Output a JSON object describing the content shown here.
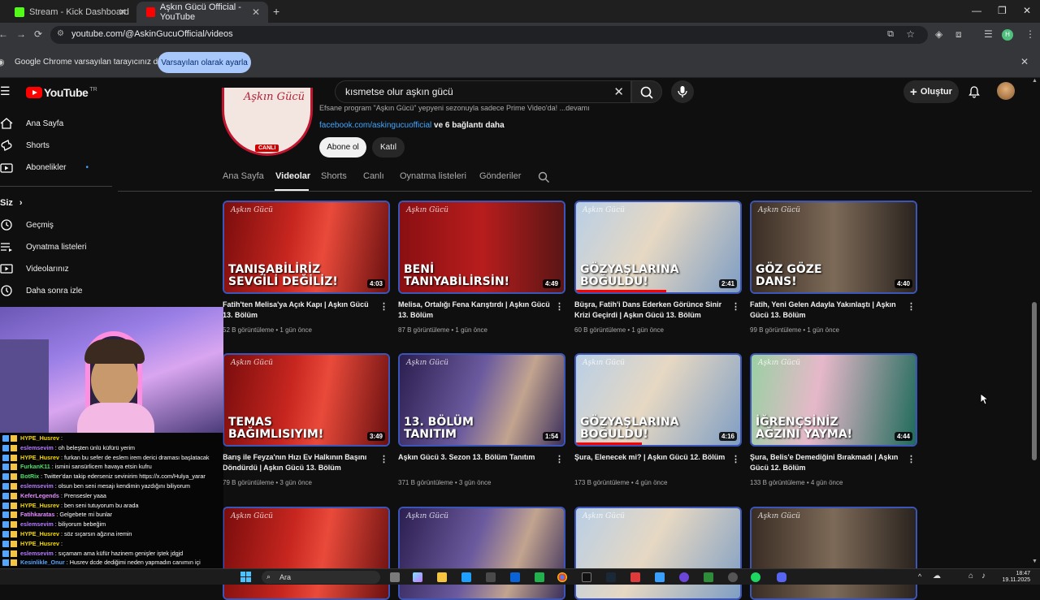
{
  "browser": {
    "tabs": [
      {
        "title": "Stream - Kick Dashboard",
        "active": false,
        "favicon_color": "#53fc18"
      },
      {
        "title": "Aşkın Gücü Official - YouTube",
        "active": true,
        "favicon_color": "#ff0000"
      }
    ],
    "url": "youtube.com/@AskinGucuOfficial/videos",
    "infobar": {
      "message": "Google Chrome varsayılan tarayıcınız değil",
      "button": "Varsayılan olarak ayarla"
    }
  },
  "youtube": {
    "logo_text": "YouTube",
    "logo_suffix": "TR",
    "search_value": "kısmetse olur aşkın gücü",
    "create_label": "Oluştur",
    "sidebar": {
      "items": [
        {
          "label": "Ana Sayfa",
          "icon": "home-icon"
        },
        {
          "label": "Shorts",
          "icon": "shorts-icon"
        },
        {
          "label": "Abonelikler",
          "icon": "subscriptions-icon"
        }
      ],
      "section": "Siz",
      "you_items": [
        {
          "label": "Geçmiş",
          "icon": "history-icon"
        },
        {
          "label": "Oynatma listeleri",
          "icon": "playlist-icon"
        },
        {
          "label": "Videolarınız",
          "icon": "your-videos-icon"
        },
        {
          "label": "Daha sonra izle",
          "icon": "watch-later-icon"
        }
      ]
    },
    "channel": {
      "live_badge": "CANLI",
      "description": "Efsane program \"Aşkın Gücü\" yepyeni sezonuyla sadece Prime Video'da! ...devamı",
      "link": "facebook.com/askingucuofficial",
      "more_links": " ve 6 bağlantı daha",
      "subscribe": "Abone ol",
      "join": "Katıl",
      "tabs": [
        "Ana Sayfa",
        "Videolar",
        "Shorts",
        "Canlı",
        "Oynatma listeleri",
        "Gönderiler"
      ],
      "active_tab": "Videolar"
    },
    "videos": [
      {
        "caption": "TANIŞABİLİRİZ\nSEVGİLİ DEĞİLİZ!",
        "duration": "4:03",
        "title": "Fatih'ten Melisa'ya Açık Kapı | Aşkın Gücü 13. Bölüm",
        "meta": "52 B görüntüleme • 1 gün önce",
        "scene": "red",
        "watched": 0
      },
      {
        "caption": "BENİ\nTANIYABİLİRSİN!",
        "duration": "4:49",
        "title": "Melisa, Ortalığı Fena Karıştırdı | Aşkın Gücü 13. Bölüm",
        "meta": "87 B görüntüleme • 1 gün önce",
        "scene": "red2",
        "watched": 0
      },
      {
        "caption": "GÖZYAŞLARINA\nBOĞULDU!",
        "duration": "2:41",
        "title": "Büşra, Fatih'i Dans Ederken Görünce Sinir Krizi Geçirdi | Aşkın Gücü 13. Bölüm",
        "meta": "60 B görüntüleme • 1 gün önce",
        "scene": "blue",
        "watched": 0.55
      },
      {
        "caption": "GÖZ GÖZE\nDANS!",
        "duration": "4:40",
        "title": "Fatih, Yeni Gelen Adayla Yakınlaştı | Aşkın Gücü 13. Bölüm",
        "meta": "99 B görüntüleme • 1 gün önce",
        "scene": "brown",
        "watched": 0
      },
      {
        "caption": "TEMAS\nBAĞIMLISIYIM!",
        "duration": "3:49",
        "title": "Barış ile Feyza'nın Hızı Ev Halkının Başını Döndürdü | Aşkın Gücü 13. Bölüm",
        "meta": "79 B görüntüleme • 3 gün önce",
        "scene": "red",
        "watched": 0
      },
      {
        "caption": "13. BÖLÜM\nTANITIM",
        "duration": "1:54",
        "title": "Aşkın Gücü 3. Sezon 13. Bölüm Tanıtım",
        "meta": "371 B görüntüleme • 3 gün önce",
        "scene": "purple",
        "watched": 0
      },
      {
        "caption": "GÖZYAŞLARINA\nBOĞULDU!",
        "duration": "4:16",
        "title": "Şura, Elenecek mi? | Aşkın Gücü 12. Bölüm",
        "meta": "173 B görüntüleme • 4 gün önce",
        "scene": "blue",
        "watched": 0.4
      },
      {
        "caption": "İĞRENÇSİNİZ\nAĞZINI YAYMA!",
        "duration": "4:44",
        "title": "Şura, Belis'e Demediğini Bırakmadı | Aşkın Gücü 12. Bölüm",
        "meta": "133 B görüntüleme • 4 gün önce",
        "scene": "green",
        "watched": 0
      },
      {
        "caption": "",
        "duration": "",
        "title": "",
        "meta": "",
        "scene": "red",
        "watched": 0
      },
      {
        "caption": "",
        "duration": "",
        "title": "",
        "meta": "",
        "scene": "purple",
        "watched": 0
      },
      {
        "caption": "",
        "duration": "",
        "title": "",
        "meta": "",
        "scene": "blue",
        "watched": 0
      },
      {
        "caption": "",
        "duration": "",
        "title": "",
        "meta": "",
        "scene": "brown",
        "watched": 0
      }
    ]
  },
  "chat": [
    {
      "user": "HYPE_Husrev",
      "text": " :",
      "color": "#f5d90a"
    },
    {
      "user": "eslemsevim",
      "text": " : oh beleşten ünlü küfürü yerim",
      "color": "#b57bff"
    },
    {
      "user": "HYPE_Husrev",
      "text": " : furkan bu sefer de eslem irem derici draması başlatacak",
      "color": "#f5d90a"
    },
    {
      "user": "FurkanK11",
      "text": " : ismini sansürlicem havaya etsin kufru",
      "color": "#4ce06b"
    },
    {
      "user": "BotRix",
      "text": " : Twitter'dan takip ederseniz sevinirim https://x.com/Hulya_yarar",
      "color": "#4ce06b"
    },
    {
      "user": "eslemsevim",
      "text": " : olsun ben seni mesajı kendimin yazdığını biliyorum",
      "color": "#b57bff"
    },
    {
      "user": "KeferLegends",
      "text": " : Prensesler yaaa",
      "color": "#e28aff"
    },
    {
      "user": "HYPE_Husrev",
      "text": " : ben seni tutuyorum bu arada",
      "color": "#f5d90a"
    },
    {
      "user": "Fatihkaratas",
      "text": " : Gelgebete mi bunlar",
      "color": "#e28aff"
    },
    {
      "user": "eslemsevim",
      "text": " : biliyorum bebeğim",
      "color": "#b57bff"
    },
    {
      "user": "HYPE_Husrev",
      "text": " : söz sıçarsın ağzına iremin",
      "color": "#f5d90a"
    },
    {
      "user": "HYPE_Husrev",
      "text": " :",
      "color": "#f5d90a"
    },
    {
      "user": "eslemsevim",
      "text": " : sıçamam ama küfür hazinem genişler iştek jdgjd",
      "color": "#b57bff"
    },
    {
      "user": "Kesinlikle_Onur",
      "text": " : Husrev dcde dediğimi neden yapmadın canımın içi",
      "color": "#53a6ff"
    }
  ],
  "taskbar": {
    "search_placeholder": "Ara",
    "time": "18:47",
    "date": "19.11.2025"
  }
}
